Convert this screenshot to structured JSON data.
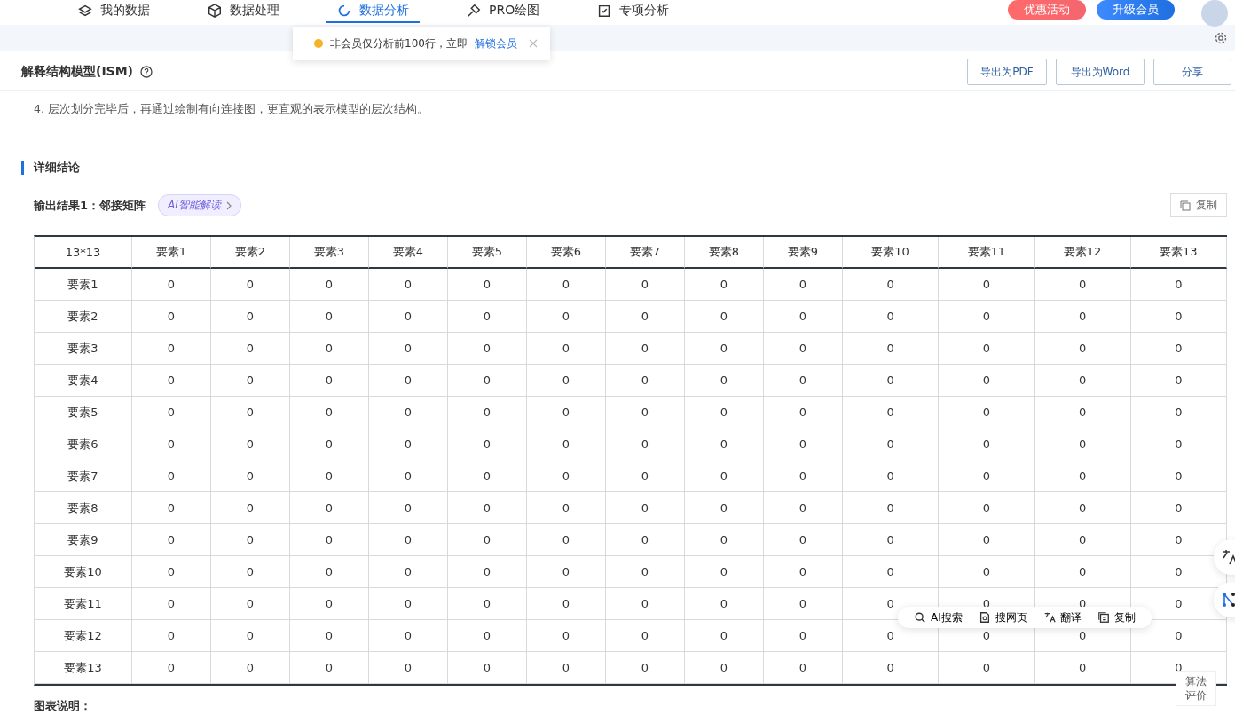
{
  "nav": {
    "tabs": [
      {
        "label": "我的数据",
        "selected": false
      },
      {
        "label": "数据处理",
        "selected": false
      },
      {
        "label": "数据分析",
        "selected": true
      },
      {
        "label": "PRO绘图",
        "selected": false
      },
      {
        "label": "专项分析",
        "selected": false
      }
    ],
    "promo_button": "优惠活动",
    "upgrade_button": "升级会员"
  },
  "toast": {
    "message": "非会员仅分析前100行，立即",
    "link": "解锁会员"
  },
  "header": {
    "title": "解释结构模型(ISM)",
    "buttons": [
      "导出为PDF",
      "导出为Word",
      "分享"
    ]
  },
  "intro_line": "4. 层次划分完毕后，再通过绘制有向连接图，更直观的表示模型的层次结构。",
  "section_title": "详细结论",
  "result": {
    "title": "输出结果1：邻接矩阵",
    "ai_chip": "AI智能解读",
    "copy_button": "复制"
  },
  "table": {
    "columns": [
      "13*13",
      "要素1",
      "要素2",
      "要素3",
      "要素4",
      "要素5",
      "要素6",
      "要素7",
      "要素8",
      "要素9",
      "要素10",
      "要素11",
      "要素12",
      "要素13"
    ],
    "rows": [
      [
        "要素1",
        "0",
        "0",
        "0",
        "0",
        "0",
        "0",
        "0",
        "0",
        "0",
        "0",
        "0",
        "0",
        "0"
      ],
      [
        "要素2",
        "0",
        "0",
        "0",
        "0",
        "0",
        "0",
        "0",
        "0",
        "0",
        "0",
        "0",
        "0",
        "0"
      ],
      [
        "要素3",
        "0",
        "0",
        "0",
        "0",
        "0",
        "0",
        "0",
        "0",
        "0",
        "0",
        "0",
        "0",
        "0"
      ],
      [
        "要素4",
        "0",
        "0",
        "0",
        "0",
        "0",
        "0",
        "0",
        "0",
        "0",
        "0",
        "0",
        "0",
        "0"
      ],
      [
        "要素5",
        "0",
        "0",
        "0",
        "0",
        "0",
        "0",
        "0",
        "0",
        "0",
        "0",
        "0",
        "0",
        "0"
      ],
      [
        "要素6",
        "0",
        "0",
        "0",
        "0",
        "0",
        "0",
        "0",
        "0",
        "0",
        "0",
        "0",
        "0",
        "0"
      ],
      [
        "要素7",
        "0",
        "0",
        "0",
        "0",
        "0",
        "0",
        "0",
        "0",
        "0",
        "0",
        "0",
        "0",
        "0"
      ],
      [
        "要素8",
        "0",
        "0",
        "0",
        "0",
        "0",
        "0",
        "0",
        "0",
        "0",
        "0",
        "0",
        "0",
        "0"
      ],
      [
        "要素9",
        "0",
        "0",
        "0",
        "0",
        "0",
        "0",
        "0",
        "0",
        "0",
        "0",
        "0",
        "0",
        "0"
      ],
      [
        "要素10",
        "0",
        "0",
        "0",
        "0",
        "0",
        "0",
        "0",
        "0",
        "0",
        "0",
        "0",
        "0",
        "0"
      ],
      [
        "要素11",
        "0",
        "0",
        "0",
        "0",
        "0",
        "0",
        "0",
        "0",
        "0",
        "0",
        "0",
        "0",
        "0"
      ],
      [
        "要素12",
        "0",
        "0",
        "0",
        "0",
        "0",
        "0",
        "0",
        "0",
        "0",
        "0",
        "0",
        "0",
        "0"
      ],
      [
        "要素13",
        "0",
        "0",
        "0",
        "0",
        "0",
        "0",
        "0",
        "0",
        "0",
        "0",
        "0",
        "0",
        "0"
      ]
    ]
  },
  "caption": "图表说明：",
  "selection_toolbar": [
    "AI搜索",
    "搜网页",
    "翻译",
    "复制"
  ],
  "rating_button": "算法评价"
}
